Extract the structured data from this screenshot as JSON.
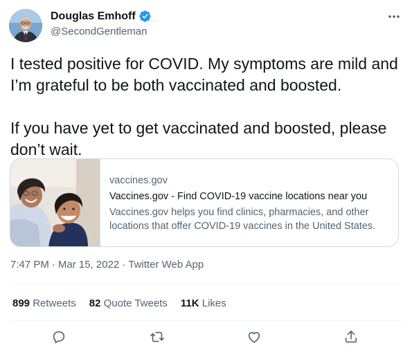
{
  "author": {
    "display_name": "Douglas Emhoff",
    "handle": "@SecondGentleman",
    "verified": true
  },
  "tweet": {
    "paragraphs": [
      "I tested positive for COVID. My symptoms are mild and I’m grateful to be both vaccinated and boosted.",
      "If you have yet to get vaccinated and boosted, please don’t wait."
    ],
    "time": "7:47 PM",
    "date": "Mar 15, 2022",
    "source": "Twitter Web App",
    "separator": "·"
  },
  "link_card": {
    "domain": "vaccines.gov",
    "title": "Vaccines.gov - Find COVID-19 vaccine locations near you",
    "description": "Vaccines.gov helps you find clinics, pharmacies, and other locations that offer COVID-19 vaccines in the United States."
  },
  "stats": {
    "retweets_count": "899",
    "retweets_label": "Retweets",
    "quotes_count": "82",
    "quotes_label": "Quote Tweets",
    "likes_count": "11K",
    "likes_label": "Likes"
  },
  "icons": {
    "more": "more-icon",
    "verified": "verified-badge-icon",
    "reply": "reply-icon",
    "retweet": "retweet-icon",
    "like": "like-icon",
    "share": "share-icon"
  },
  "colors": {
    "text_primary": "#0f1419",
    "text_secondary": "#536471",
    "verified_blue": "#1d9bf0",
    "border": "#cfd9de"
  }
}
